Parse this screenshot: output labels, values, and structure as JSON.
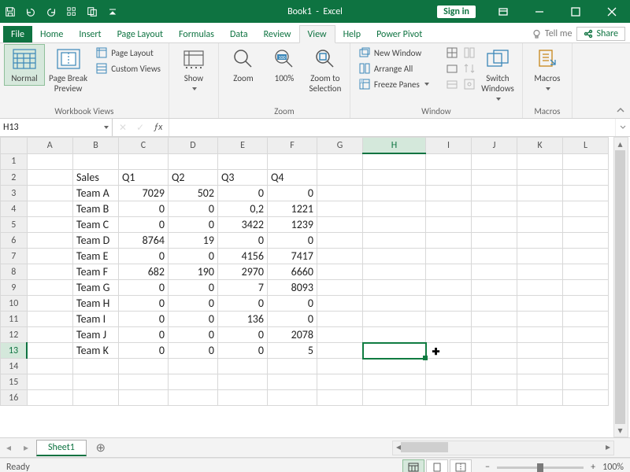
{
  "title": {
    "doc": "Book1",
    "app": "Excel",
    "signin": "Sign in"
  },
  "tabs": {
    "file": "File",
    "items": [
      "Home",
      "Insert",
      "Page Layout",
      "Formulas",
      "Data",
      "Review",
      "View",
      "Help",
      "Power Pivot"
    ],
    "active_index": 6,
    "tellme": "Tell me",
    "share": "Share"
  },
  "ribbon": {
    "groups": {
      "workbook_views": {
        "label": "Workbook Views",
        "normal": "Normal",
        "page_break": "Page Break\nPreview",
        "page_layout": "Page Layout",
        "custom_views": "Custom Views"
      },
      "show": {
        "label": "",
        "show": "Show"
      },
      "zoom": {
        "label": "Zoom",
        "zoom": "Zoom",
        "pct": "100%",
        "selection": "Zoom to\nSelection"
      },
      "window": {
        "label": "Window",
        "new_window": "New Window",
        "arrange_all": "Arrange All",
        "freeze": "Freeze Panes",
        "switch": "Switch\nWindows"
      },
      "macros": {
        "label": "Macros",
        "macros": "Macros"
      }
    }
  },
  "formula_bar": {
    "namebox": "H13",
    "formula": ""
  },
  "grid": {
    "columns": [
      "A",
      "B",
      "C",
      "D",
      "E",
      "F",
      "G",
      "H",
      "I",
      "J",
      "K",
      "L"
    ],
    "row_count": 16,
    "selected": {
      "col": "H",
      "row": 13
    },
    "headers": {
      "row": 2,
      "start_col": "B",
      "labels": [
        "Sales",
        "Q1",
        "Q2",
        "Q3",
        "Q4"
      ]
    },
    "data_rows": [
      {
        "row": 3,
        "label": "Team A",
        "values": [
          "7029",
          "502",
          "0",
          "0"
        ]
      },
      {
        "row": 4,
        "label": "Team B",
        "values": [
          "0",
          "0",
          "0,2",
          "1221"
        ]
      },
      {
        "row": 5,
        "label": "Team C",
        "values": [
          "0",
          "0",
          "3422",
          "1239"
        ]
      },
      {
        "row": 6,
        "label": "Team D",
        "values": [
          "8764",
          "19",
          "0",
          "0"
        ]
      },
      {
        "row": 7,
        "label": "Team E",
        "values": [
          "0",
          "0",
          "4156",
          "7417"
        ]
      },
      {
        "row": 8,
        "label": "Team F",
        "values": [
          "682",
          "190",
          "2970",
          "6660"
        ]
      },
      {
        "row": 9,
        "label": "Team G",
        "values": [
          "0",
          "0",
          "7",
          "8093"
        ]
      },
      {
        "row": 10,
        "label": "Team H",
        "values": [
          "0",
          "0",
          "0",
          "0"
        ]
      },
      {
        "row": 11,
        "label": "Team I",
        "values": [
          "0",
          "0",
          "136",
          "0"
        ]
      },
      {
        "row": 12,
        "label": "Team J",
        "values": [
          "0",
          "0",
          "0",
          "2078"
        ]
      },
      {
        "row": 13,
        "label": "Team K",
        "values": [
          "0",
          "0",
          "0",
          "5"
        ]
      }
    ]
  },
  "sheets": {
    "active": "Sheet1"
  },
  "status": {
    "state": "Ready",
    "zoom": "100%"
  },
  "chart_data": {
    "type": "table",
    "title": "Sales",
    "categories": [
      "Team A",
      "Team B",
      "Team C",
      "Team D",
      "Team E",
      "Team F",
      "Team G",
      "Team H",
      "Team I",
      "Team J",
      "Team K"
    ],
    "series": [
      {
        "name": "Q1",
        "values": [
          7029,
          0,
          0,
          8764,
          0,
          682,
          0,
          0,
          0,
          0,
          0
        ]
      },
      {
        "name": "Q2",
        "values": [
          502,
          0,
          0,
          19,
          0,
          190,
          0,
          0,
          0,
          0,
          0
        ]
      },
      {
        "name": "Q3",
        "values": [
          0,
          0.2,
          3422,
          0,
          4156,
          2970,
          7,
          0,
          136,
          0,
          0
        ]
      },
      {
        "name": "Q4",
        "values": [
          0,
          1221,
          1239,
          0,
          7417,
          6660,
          8093,
          0,
          0,
          2078,
          5
        ]
      }
    ]
  }
}
